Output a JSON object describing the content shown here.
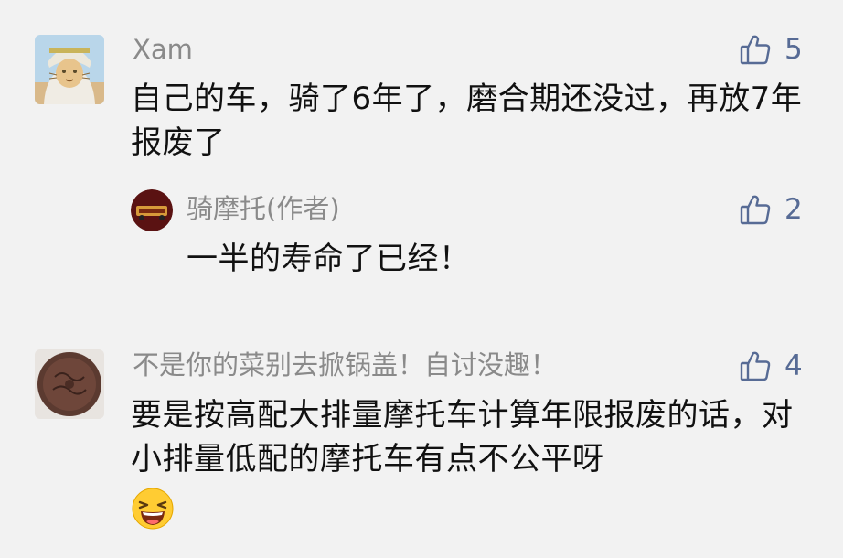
{
  "comments": [
    {
      "author": "Xam",
      "text": "自己的车，骑了6年了，磨合期还没过，再放7年报废了",
      "likes": "5",
      "reply": {
        "author": "骑摩托(作者)",
        "text": "一半的寿命了已经！",
        "likes": "2"
      }
    },
    {
      "author": "不是你的菜别去掀锅盖！自讨没趣！",
      "text": "要是按高配大排量摩托车计算年限报废的话，对小排量低配的摩托车有点不公平呀",
      "likes": "4",
      "emoji": "😆"
    }
  ],
  "icons": {
    "like": "thumbs-up-icon",
    "accent_color": "#576b95"
  }
}
